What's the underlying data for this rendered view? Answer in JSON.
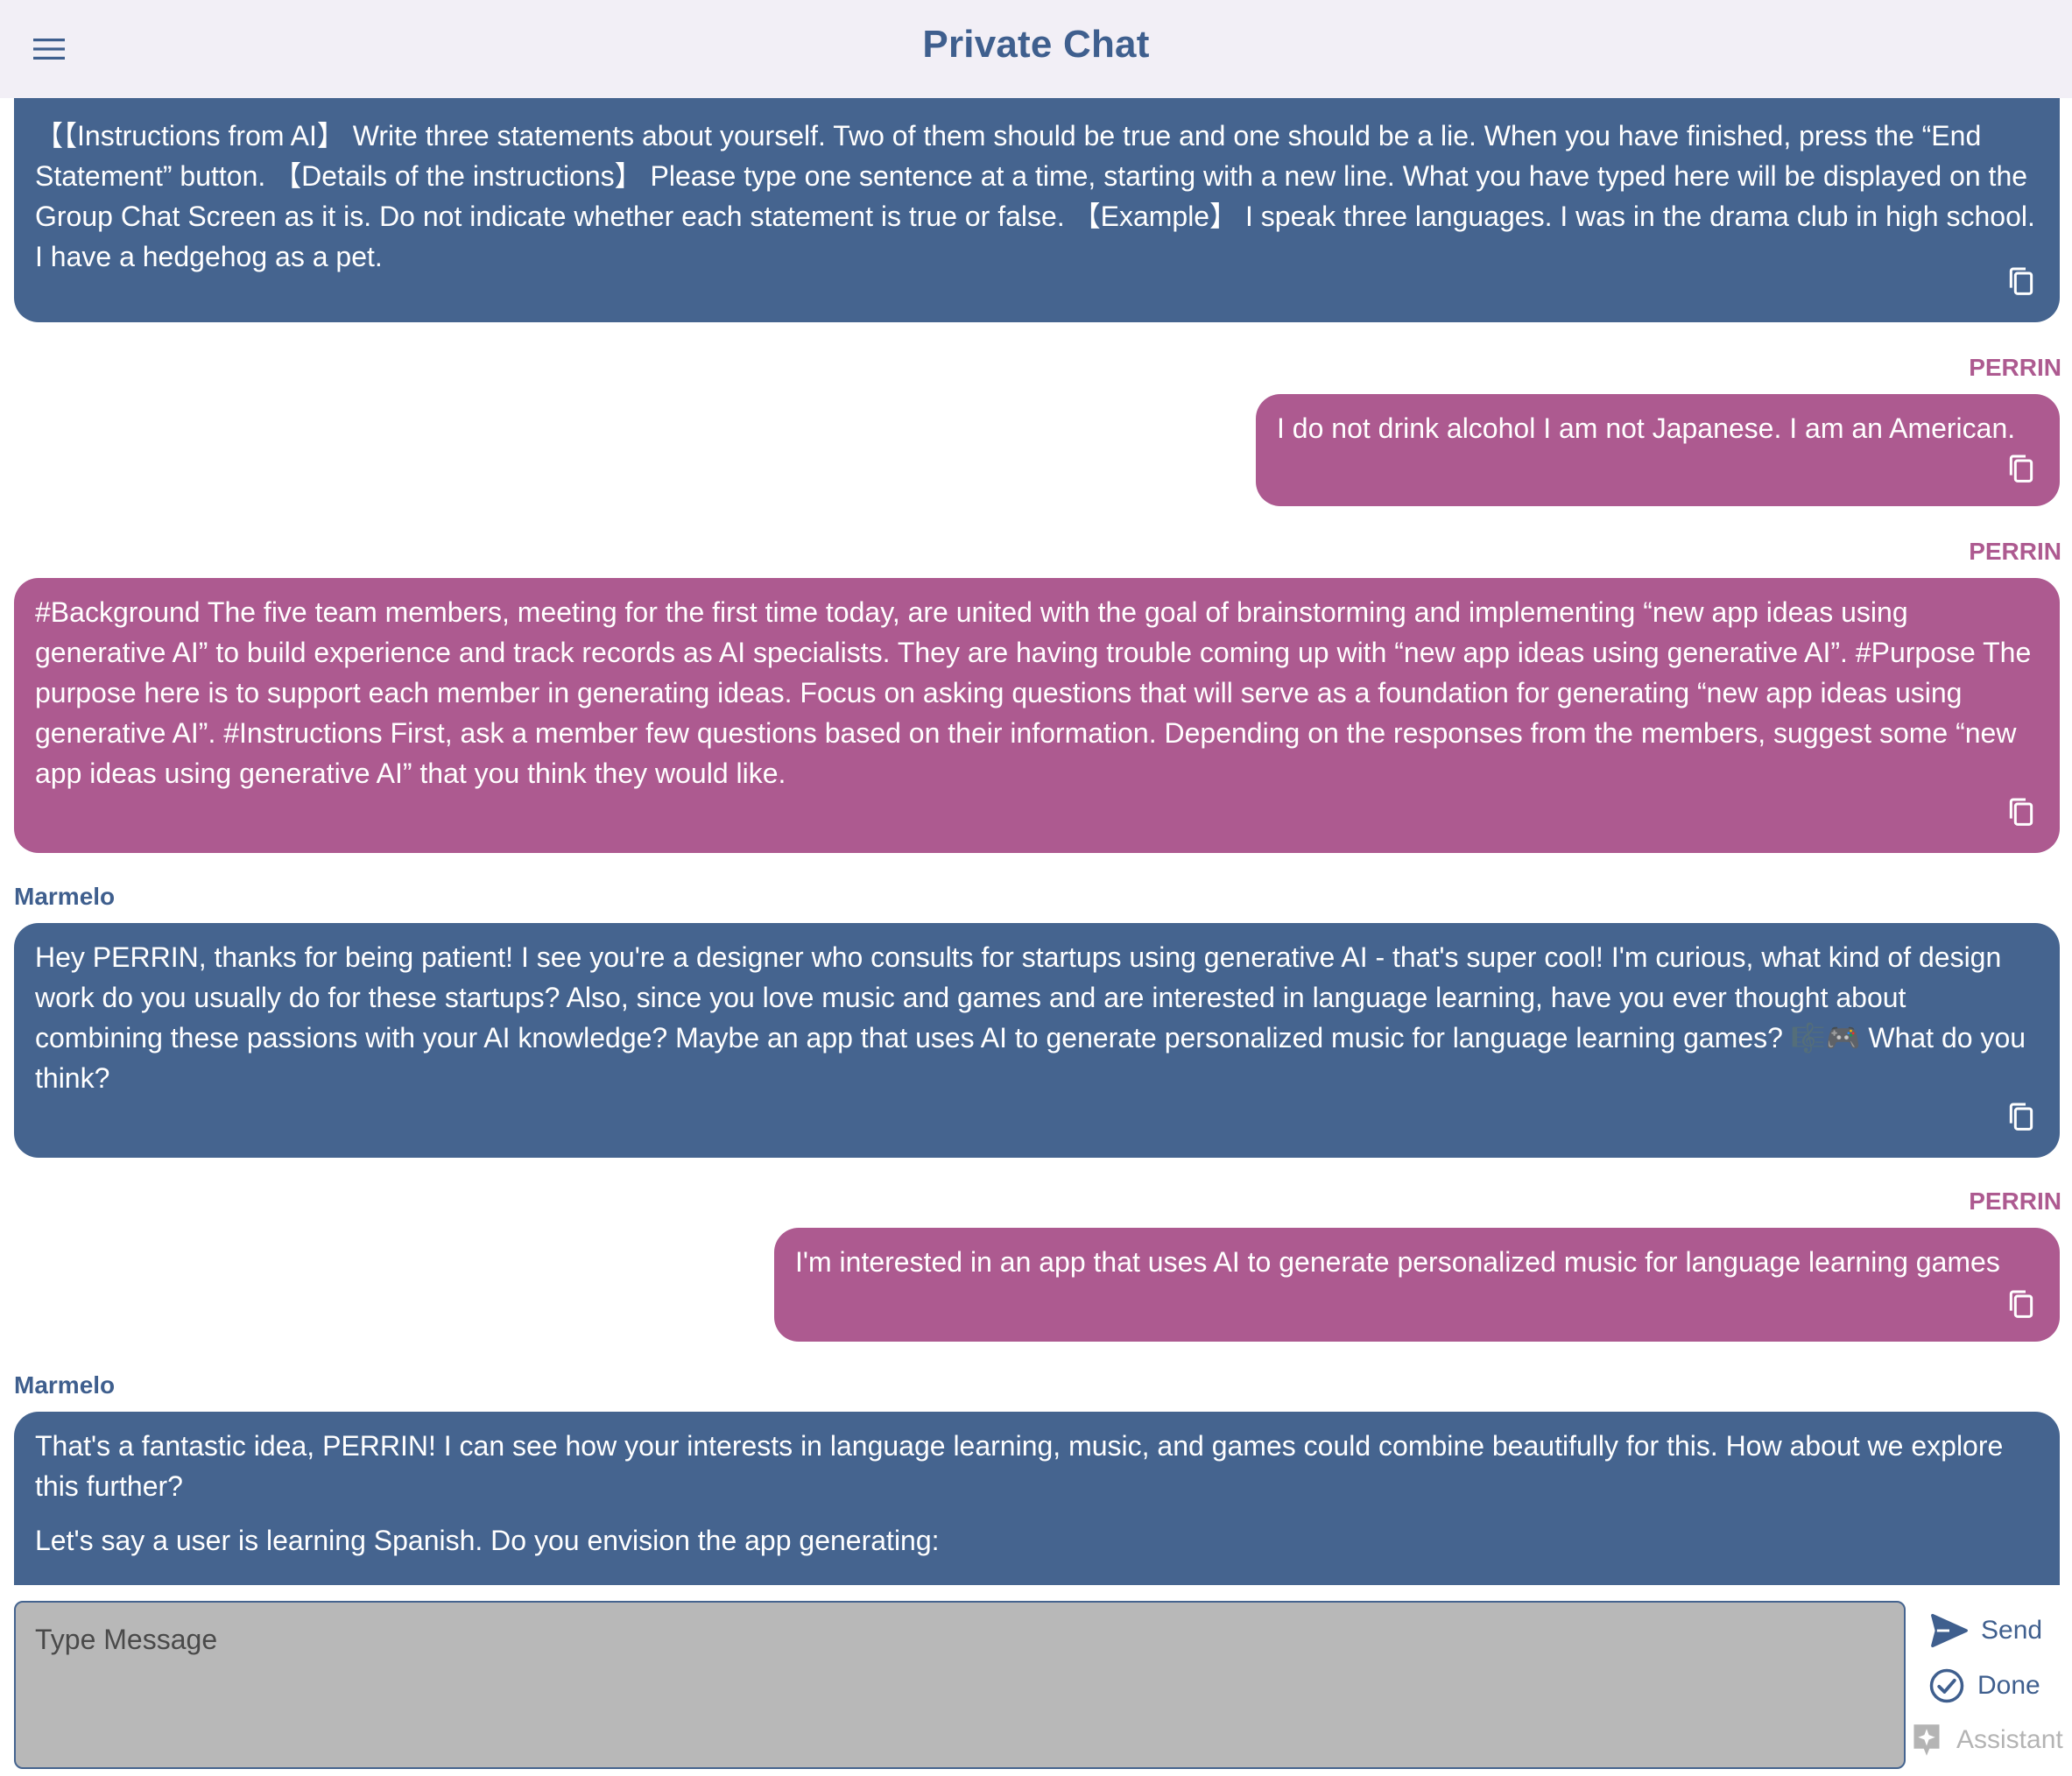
{
  "header": {
    "title": "Private Chat",
    "menu_icon": "hamburger-menu-icon"
  },
  "colors": {
    "ai_bubble": "#45648f",
    "user_bubble": "#ad5a90",
    "header_bg": "#f2eff6",
    "input_bg": "#b8b8b8"
  },
  "messages": [
    {
      "role": "ai",
      "sender": "",
      "paragraphs": [
        "【【Instructions from AI】 Write three statements about yourself. Two of them should be true and one should be a lie. When you have finished, press the “End Statement” button. 【Details of the instructions】 Please type one sentence at a time, starting with a new line. What you have typed here will be displayed on the Group Chat Screen as it is. Do not indicate whether each statement is true or false. 【Example】 I speak three languages. I was in the drama club in high school. I have a hedgehog as a pet."
      ]
    },
    {
      "role": "user",
      "sender": "PERRIN",
      "paragraphs": [
        "I do not drink alcohol I am not Japanese. I am an American."
      ]
    },
    {
      "role": "user",
      "sender": "PERRIN",
      "paragraphs": [
        "#Background The five team members, meeting for the first time today, are united with the goal of brainstorming and implementing “new app ideas using generative AI” to build experience and track records as AI specialists. They are having trouble coming up with “new app ideas using generative AI”. #Purpose The purpose here is to support each member in generating ideas. Focus on asking questions that will serve as a foundation for generating “new app ideas using generative AI”. #Instructions First, ask a member few questions based on their information. Depending on the responses from the members, suggest some “new app ideas using generative AI” that you think they would like."
      ]
    },
    {
      "role": "ai",
      "sender": "Marmelo",
      "paragraphs": [
        "Hey PERRIN, thanks for being patient!  I see you're a designer who consults for startups using generative AI - that's super cool! I'm curious, what kind of design work do you usually do for these startups?  Also,  since you love music and games and are interested in language learning, have you ever thought about combining these passions with your AI knowledge?  Maybe an app that uses AI to generate personalized music for language learning games? 🎼🎮 What do you think?"
      ]
    },
    {
      "role": "user",
      "sender": "PERRIN",
      "paragraphs": [
        "I'm interested in an app that uses AI to generate personalized music for language learning games"
      ]
    },
    {
      "role": "ai",
      "sender": "Marmelo",
      "paragraphs": [
        "That's a fantastic idea, PERRIN! I can see how your interests in language learning, music, and games could combine beautifully for this.  How about we explore this further?",
        "Let's say a user is learning Spanish.  Do you envision the app generating:"
      ]
    }
  ],
  "composer": {
    "placeholder": "Type Message",
    "value": "",
    "send_label": "Send",
    "done_label": "Done",
    "assistant_label": "Assistant"
  },
  "icons": {
    "copy": "copy-icon",
    "send": "send-icon",
    "done": "check-circle-icon",
    "assistant": "sparkle-icon"
  }
}
